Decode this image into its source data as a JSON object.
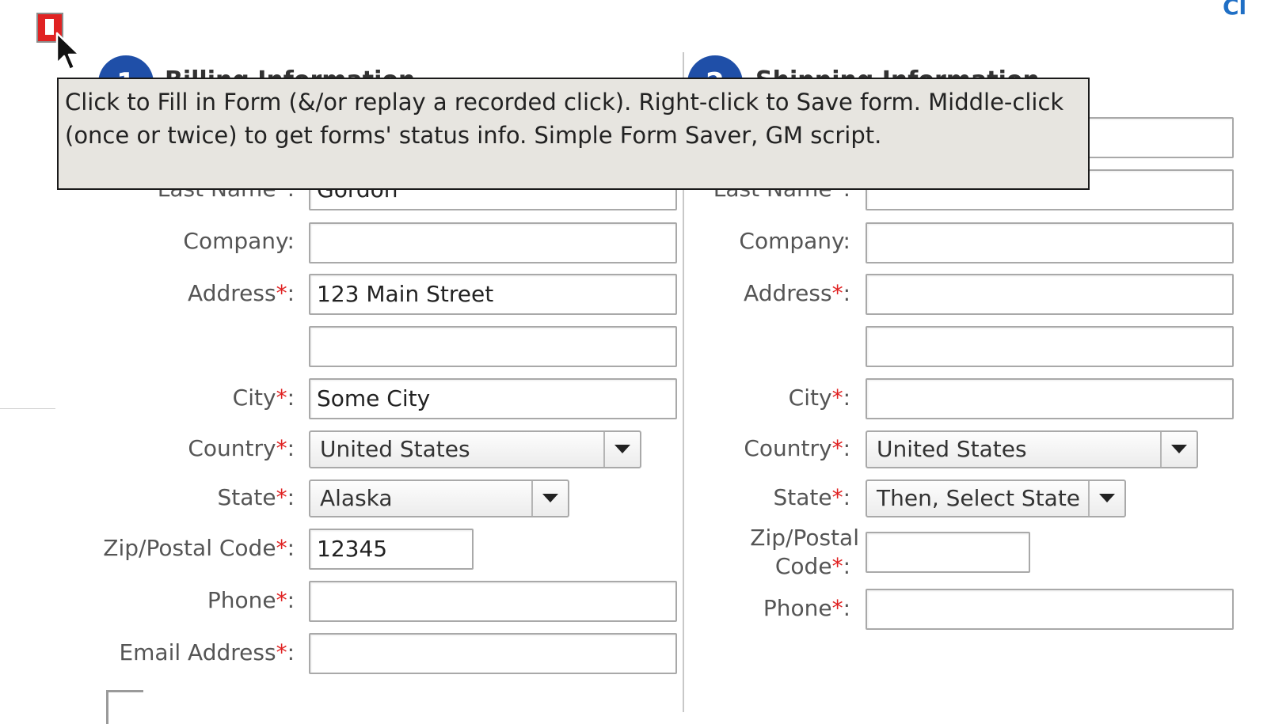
{
  "top_link": "Cl",
  "billing": {
    "step": "1",
    "heading": "Billing Information",
    "fields": {
      "last_name_label": "Last Name",
      "last_name_value": "Gordon",
      "company_label": "Company:",
      "company_value": "",
      "address_label": "Address",
      "address_value": "123 Main Street",
      "address2_value": "",
      "city_label": "City",
      "city_value": "Some City",
      "country_label": "Country",
      "country_value": "United States",
      "state_label": "State",
      "state_value": "Alaska",
      "zip_label": "Zip/Postal Code",
      "zip_value": "12345",
      "phone_label": "Phone",
      "phone_value": "",
      "email_label": "Email Address",
      "email_value": ""
    }
  },
  "shipping": {
    "step": "2",
    "heading": "Shipping Information",
    "fields": {
      "last_name_label": "Last Name",
      "company_label": "Company:",
      "address_label": "Address",
      "city_label": "City",
      "country_label": "Country",
      "country_value": "United States",
      "state_label": "State",
      "state_value": "Then, Select State",
      "zip_label_line1": "Zip/Postal",
      "zip_label_line2": "Code",
      "phone_label": "Phone"
    }
  },
  "required_marker": "*",
  "colon": ":",
  "tooltip": {
    "text": "Click to Fill in Form (&/or replay a recorded click).  Right-click to Save form.  Middle-click (once or twice) to get forms' status info.  Simple Form Saver, GM script."
  },
  "icons": {
    "saver": "form-saver-icon",
    "cursor": "mouse-pointer-icon",
    "dropdown": "chevron-down-icon"
  },
  "colors": {
    "required": "#e02222",
    "step_circle": "#1f4fa8",
    "link": "#1f6fc5",
    "tooltip_bg": "#e7e5e0"
  }
}
